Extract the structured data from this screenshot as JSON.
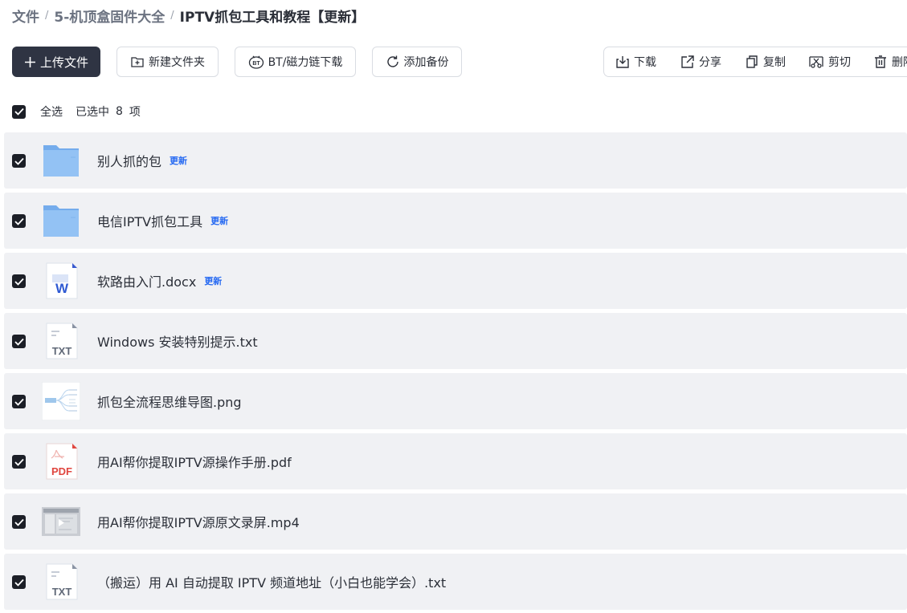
{
  "breadcrumb": [
    "文件",
    "5-机顶盒固件大全",
    "IPTV抓包工具和教程【更新】"
  ],
  "actions": {
    "upload": "上传文件",
    "new_folder": "新建文件夹",
    "bt": "BT/磁力链下载",
    "backup": "添加备份"
  },
  "toolbar": {
    "download": "下载",
    "share": "分享",
    "copy": "复制",
    "cut": "剪切",
    "delete": "删除"
  },
  "selection": {
    "select_all": "全选",
    "selected_prefix": "已选中",
    "count": "8",
    "suffix": "项"
  },
  "badge_text": "更新",
  "files": [
    {
      "name": "别人抓的包",
      "type": "folder-icon",
      "badge": "更新",
      "checked": true
    },
    {
      "name": "电信IPTV抓包工具",
      "type": "folder-icon",
      "badge": "更新",
      "checked": true
    },
    {
      "name": "软路由入门.docx",
      "type": "word-doc-icon",
      "badge": "更新",
      "checked": true
    },
    {
      "name": "Windows 安装特别提示.txt",
      "type": "txt-file-icon",
      "badge": "",
      "checked": true
    },
    {
      "name": "抓包全流程思维导图.png",
      "type": "image-thumbnail",
      "badge": "",
      "checked": true
    },
    {
      "name": "用AI帮你提取IPTV源操作手册.pdf",
      "type": "pdf-file-icon",
      "badge": "",
      "checked": true
    },
    {
      "name": "用AI帮你提取IPTV源原文录屏.mp4",
      "type": "video-thumbnail",
      "badge": "",
      "checked": true
    },
    {
      "name": "（搬运）用 AI 自动提取 IPTV 频道地址（小白也能学会）.txt",
      "type": "txt-file-icon",
      "badge": "",
      "checked": true
    }
  ],
  "colors": {
    "accent": "#2468f2",
    "primary_button": "#2f3443",
    "row_bg": "#f0f1f4",
    "folder": "#7cb4f0"
  }
}
